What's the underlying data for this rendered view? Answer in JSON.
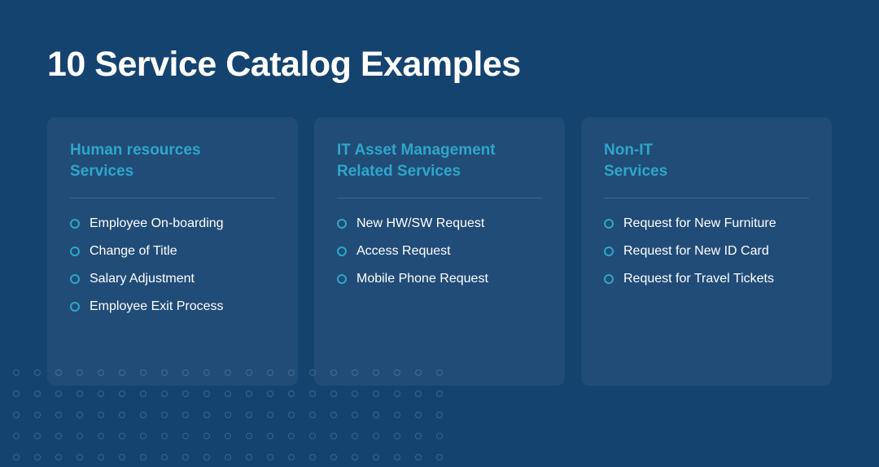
{
  "title": "10 Service Catalog Examples",
  "cards": [
    {
      "title": "Human resources\nServices",
      "items": [
        "Employee On-boarding",
        "Change of Title",
        "Salary Adjustment",
        "Employee Exit Process"
      ]
    },
    {
      "title": "IT Asset Management\nRelated Services",
      "items": [
        "New HW/SW Request",
        "Access Request",
        "Mobile Phone Request"
      ]
    },
    {
      "title": "Non-IT\nServices",
      "items": [
        "Request for New Furniture",
        "Request for New ID Card",
        "Request for Travel Tickets"
      ]
    }
  ],
  "colors": {
    "background": "#154370",
    "accent": "#2fa6c9",
    "cardBg": "rgba(255,255,255,0.05)"
  }
}
